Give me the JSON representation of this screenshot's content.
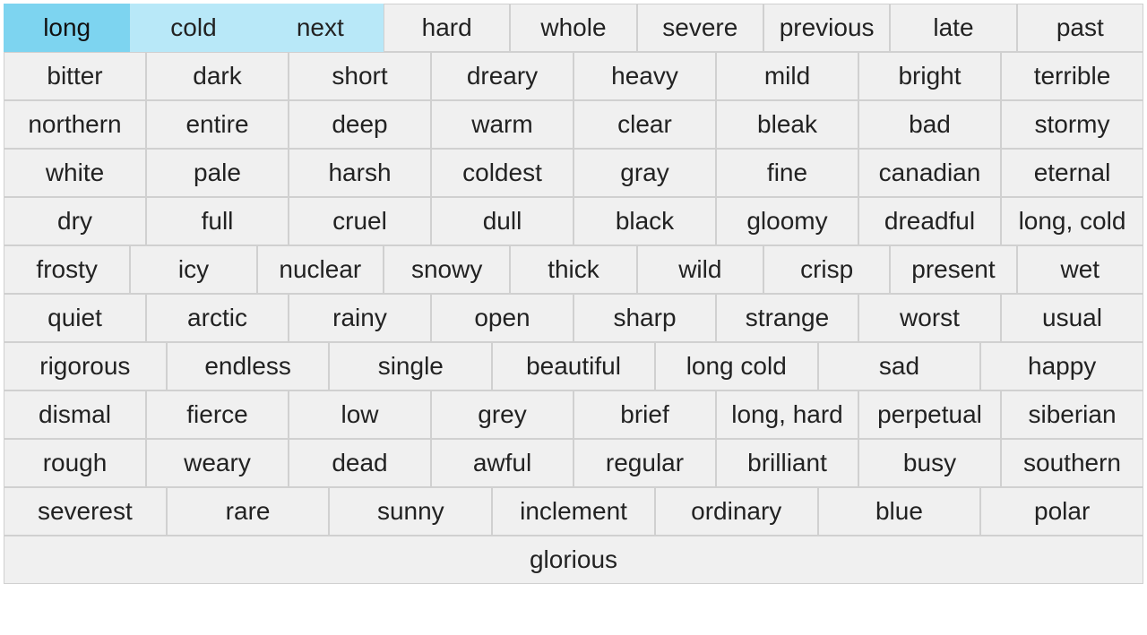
{
  "rows": [
    [
      {
        "label": "long",
        "state": "active"
      },
      {
        "label": "cold",
        "state": "light-blue"
      },
      {
        "label": "next",
        "state": "light-blue"
      },
      {
        "label": "hard",
        "state": "normal"
      },
      {
        "label": "whole",
        "state": "normal"
      },
      {
        "label": "severe",
        "state": "normal"
      },
      {
        "label": "previous",
        "state": "normal"
      },
      {
        "label": "late",
        "state": "normal"
      },
      {
        "label": "past",
        "state": "normal"
      }
    ],
    [
      {
        "label": "bitter",
        "state": "normal"
      },
      {
        "label": "dark",
        "state": "normal"
      },
      {
        "label": "short",
        "state": "normal"
      },
      {
        "label": "dreary",
        "state": "normal"
      },
      {
        "label": "heavy",
        "state": "normal"
      },
      {
        "label": "mild",
        "state": "normal"
      },
      {
        "label": "bright",
        "state": "normal"
      },
      {
        "label": "terrible",
        "state": "normal"
      }
    ],
    [
      {
        "label": "northern",
        "state": "normal"
      },
      {
        "label": "entire",
        "state": "normal"
      },
      {
        "label": "deep",
        "state": "normal"
      },
      {
        "label": "warm",
        "state": "normal"
      },
      {
        "label": "clear",
        "state": "normal"
      },
      {
        "label": "bleak",
        "state": "normal"
      },
      {
        "label": "bad",
        "state": "normal"
      },
      {
        "label": "stormy",
        "state": "normal"
      }
    ],
    [
      {
        "label": "white",
        "state": "normal"
      },
      {
        "label": "pale",
        "state": "normal"
      },
      {
        "label": "harsh",
        "state": "normal"
      },
      {
        "label": "coldest",
        "state": "normal"
      },
      {
        "label": "gray",
        "state": "normal"
      },
      {
        "label": "fine",
        "state": "normal"
      },
      {
        "label": "canadian",
        "state": "normal"
      },
      {
        "label": "eternal",
        "state": "normal"
      }
    ],
    [
      {
        "label": "dry",
        "state": "normal"
      },
      {
        "label": "full",
        "state": "normal"
      },
      {
        "label": "cruel",
        "state": "normal"
      },
      {
        "label": "dull",
        "state": "normal"
      },
      {
        "label": "black",
        "state": "normal"
      },
      {
        "label": "gloomy",
        "state": "normal"
      },
      {
        "label": "dreadful",
        "state": "normal"
      },
      {
        "label": "long, cold",
        "state": "normal"
      }
    ],
    [
      {
        "label": "frosty",
        "state": "normal"
      },
      {
        "label": "icy",
        "state": "normal"
      },
      {
        "label": "nuclear",
        "state": "normal"
      },
      {
        "label": "snowy",
        "state": "normal"
      },
      {
        "label": "thick",
        "state": "normal"
      },
      {
        "label": "wild",
        "state": "normal"
      },
      {
        "label": "crisp",
        "state": "normal"
      },
      {
        "label": "present",
        "state": "normal"
      },
      {
        "label": "wet",
        "state": "normal"
      }
    ],
    [
      {
        "label": "quiet",
        "state": "normal"
      },
      {
        "label": "arctic",
        "state": "normal"
      },
      {
        "label": "rainy",
        "state": "normal"
      },
      {
        "label": "open",
        "state": "normal"
      },
      {
        "label": "sharp",
        "state": "normal"
      },
      {
        "label": "strange",
        "state": "normal"
      },
      {
        "label": "worst",
        "state": "normal"
      },
      {
        "label": "usual",
        "state": "normal"
      }
    ],
    [
      {
        "label": "rigorous",
        "state": "normal"
      },
      {
        "label": "endless",
        "state": "normal"
      },
      {
        "label": "single",
        "state": "normal"
      },
      {
        "label": "beautiful",
        "state": "normal"
      },
      {
        "label": "long cold",
        "state": "normal"
      },
      {
        "label": "sad",
        "state": "normal"
      },
      {
        "label": "happy",
        "state": "normal"
      }
    ],
    [
      {
        "label": "dismal",
        "state": "normal"
      },
      {
        "label": "fierce",
        "state": "normal"
      },
      {
        "label": "low",
        "state": "normal"
      },
      {
        "label": "grey",
        "state": "normal"
      },
      {
        "label": "brief",
        "state": "normal"
      },
      {
        "label": "long, hard",
        "state": "normal"
      },
      {
        "label": "perpetual",
        "state": "normal"
      },
      {
        "label": "siberian",
        "state": "normal"
      }
    ],
    [
      {
        "label": "rough",
        "state": "normal"
      },
      {
        "label": "weary",
        "state": "normal"
      },
      {
        "label": "dead",
        "state": "normal"
      },
      {
        "label": "awful",
        "state": "normal"
      },
      {
        "label": "regular",
        "state": "normal"
      },
      {
        "label": "brilliant",
        "state": "normal"
      },
      {
        "label": "busy",
        "state": "normal"
      },
      {
        "label": "southern",
        "state": "normal"
      }
    ],
    [
      {
        "label": "severest",
        "state": "normal"
      },
      {
        "label": "rare",
        "state": "normal"
      },
      {
        "label": "sunny",
        "state": "normal"
      },
      {
        "label": "inclement",
        "state": "normal"
      },
      {
        "label": "ordinary",
        "state": "normal"
      },
      {
        "label": "blue",
        "state": "normal"
      },
      {
        "label": "polar",
        "state": "normal"
      }
    ],
    [
      {
        "label": "glorious",
        "state": "normal"
      }
    ]
  ]
}
